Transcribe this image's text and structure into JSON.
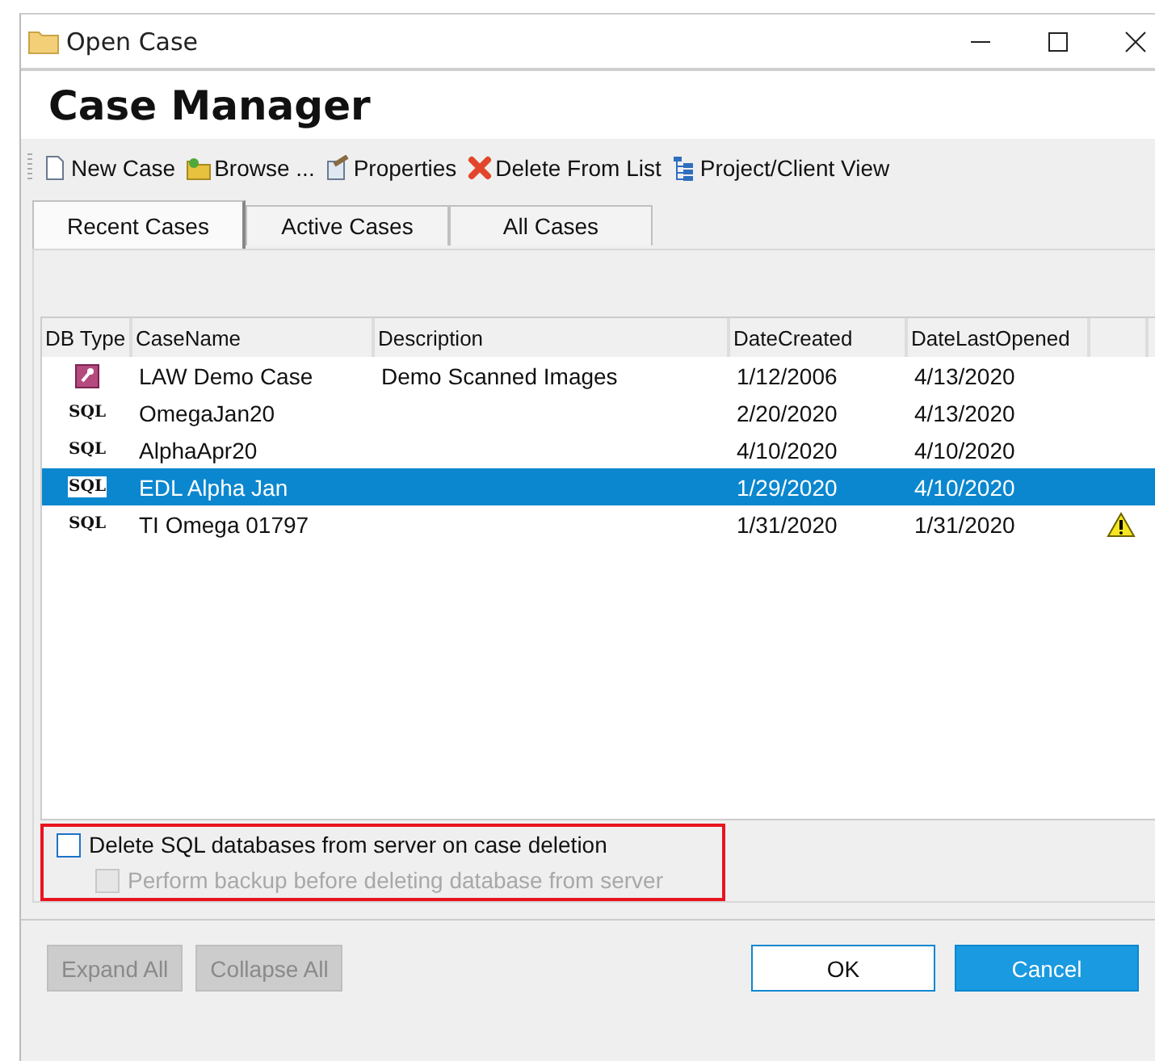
{
  "window": {
    "title": "Open Case"
  },
  "header": {
    "title": "Case Manager"
  },
  "toolbar": [
    {
      "kind": "new",
      "label": "New Case"
    },
    {
      "kind": "browse",
      "label": "Browse ..."
    },
    {
      "kind": "properties",
      "label": "Properties"
    },
    {
      "kind": "delete",
      "label": "Delete From List"
    },
    {
      "kind": "tree",
      "label": "Project/Client View"
    }
  ],
  "tabs": [
    {
      "label": "Recent Cases",
      "selected": true
    },
    {
      "label": "Active Cases",
      "selected": false
    },
    {
      "label": "All Cases",
      "selected": false
    }
  ],
  "table": {
    "columns": [
      "DB Type",
      "CaseName",
      "Description",
      "DateCreated",
      "DateLastOpened"
    ],
    "rows": [
      {
        "kind": "access",
        "name": "LAW Demo Case",
        "description": "Demo Scanned Images",
        "created": "1/12/2006",
        "opened": "4/13/2020",
        "selected": false,
        "warning": false
      },
      {
        "kind": "sql",
        "db_label": "SQL",
        "name": "OmegaJan20",
        "created": "2/20/2020",
        "opened": "4/13/2020",
        "selected": false,
        "warning": false
      },
      {
        "kind": "sql",
        "db_label": "SQL",
        "name": "AlphaApr20",
        "created": "4/10/2020",
        "opened": "4/10/2020",
        "selected": false,
        "warning": false
      },
      {
        "kind": "sql",
        "db_label": "SQL",
        "name": "EDL Alpha Jan",
        "created": "1/29/2020",
        "opened": "4/10/2020",
        "selected": true,
        "warning": false
      },
      {
        "kind": "sql",
        "db_label": "SQL",
        "name": "TI Omega 01797",
        "created": "1/31/2020",
        "opened": "1/31/2020",
        "selected": false,
        "warning": true
      }
    ]
  },
  "options": [
    {
      "label": "Delete SQL databases from server on case deletion",
      "checked": false,
      "disabled": false
    },
    {
      "label": "Perform backup before deleting database from server",
      "checked": false,
      "disabled": true
    }
  ],
  "buttons": [
    {
      "label": "Expand All",
      "disabled": true,
      "primary": false
    },
    {
      "label": "Collapse All",
      "disabled": true,
      "primary": false
    },
    {
      "label": "OK",
      "disabled": false,
      "primary": false
    },
    {
      "label": "Cancel",
      "disabled": false,
      "primary": true
    }
  ]
}
